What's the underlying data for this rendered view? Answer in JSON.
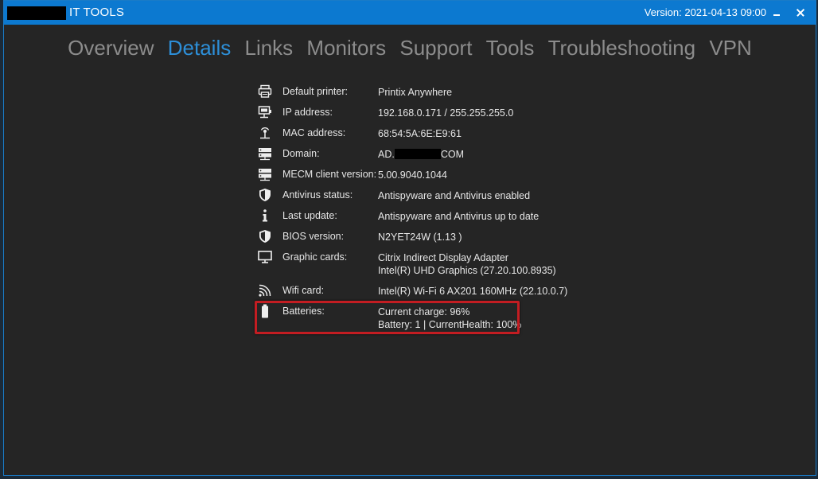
{
  "window": {
    "title": "IT TOOLS",
    "version": "Version: 2021-04-13 09:00"
  },
  "tabs": [
    "Overview",
    "Details",
    "Links",
    "Monitors",
    "Support",
    "Tools",
    "Troubleshooting",
    "VPN"
  ],
  "active_tab": "Details",
  "details": {
    "default_printer": {
      "label": "Default printer:",
      "value": "Printix Anywhere",
      "icon": "printer-icon"
    },
    "ip_address": {
      "label": "IP address:",
      "value": "192.168.0.171 / 255.255.255.0",
      "icon": "network-icon"
    },
    "mac_address": {
      "label": "MAC address:",
      "value": "68:54:5A:6E:E9:61",
      "icon": "mac-network-icon"
    },
    "domain": {
      "label": "Domain:",
      "value_prefix": "AD.",
      "value_suffix": "COM",
      "icon": "server-icon"
    },
    "mecm": {
      "label": "MECM client version:",
      "value": "5.00.9040.1044",
      "icon": "server-icon"
    },
    "antivirus": {
      "label": "Antivirus status:",
      "value": "Antispyware and Antivirus enabled",
      "icon": "shield-icon"
    },
    "last_update": {
      "label": "Last update:",
      "value": "Antispyware and Antivirus up to date",
      "icon": "info-icon"
    },
    "bios": {
      "label": "BIOS version:",
      "value": "N2YET24W (1.13 )",
      "icon": "shield-icon"
    },
    "graphic_cards": {
      "label": "Graphic cards:",
      "value_line1": "Citrix Indirect Display Adapter",
      "value_line2": "Intel(R) UHD Graphics (27.20.100.8935)",
      "icon": "monitor-icon"
    },
    "wifi": {
      "label": "Wifi card:",
      "value": "Intel(R) Wi-Fi 6 AX201 160MHz (22.10.0.7)",
      "icon": "wifi-icon"
    },
    "batteries": {
      "label": "Batteries:",
      "value_line1": "Current charge: 96%",
      "value_line2": "Battery: 1 | CurrentHealth: 100%",
      "icon": "battery-icon"
    }
  },
  "colors": {
    "titlebar": "#0c79d0",
    "background": "#252525",
    "active_tab": "#2d8fd8",
    "inactive_tab": "#8c8c8c",
    "highlight_border": "#c31d22"
  }
}
